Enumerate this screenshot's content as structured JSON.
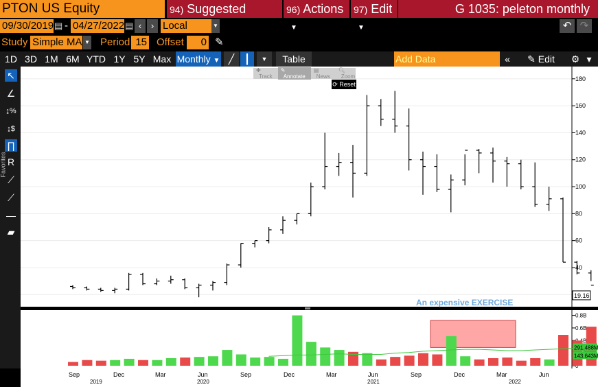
{
  "header": {
    "ticker": "PTON US Equity",
    "menu_suggested_num": "94)",
    "menu_suggested": "Suggested Charts",
    "menu_actions_num": "96)",
    "menu_actions": "Actions",
    "menu_edit_num": "97)",
    "menu_edit": "Edit",
    "chart_title": "G 1035: peleton monthly"
  },
  "range": {
    "start": "09/30/2019",
    "end": "04/27/2022",
    "currency": "Local CCY"
  },
  "study": {
    "label": "Study",
    "type": "Simple MA",
    "period_label": "Period",
    "period": "15",
    "offset_label": "Offset",
    "offset": "0"
  },
  "toolbar": {
    "periods": [
      "1D",
      "3D",
      "1M",
      "6M",
      "YTD",
      "1Y",
      "5Y",
      "Max"
    ],
    "frequency": "Monthly",
    "table_label": "Table",
    "add_data_placeholder": "Add Data",
    "edit_chart": "Edit Chart"
  },
  "chart_tools": {
    "track": "Track",
    "annotate": "Annotate",
    "news": "News",
    "zoom": "Zoom",
    "reset": "Reset"
  },
  "favorites_label": "Favorites",
  "annotation": "An expensive EXERCISE",
  "colors": {
    "up": "#4ed84e",
    "down": "#e84a4a",
    "ma": "#3cc83c",
    "orange": "#f7941d",
    "red": "#a8172b",
    "highlight": "#ff8080"
  },
  "chart_data": {
    "type": "ohlc",
    "price_axis": {
      "ticks": [
        20,
        40,
        60,
        80,
        100,
        120,
        140,
        160,
        180
      ],
      "range": [
        12,
        185
      ],
      "last_value": "19.16"
    },
    "volume_axis": {
      "ticks": [
        "0",
        "0.2B",
        "0.4B",
        "0.6B",
        "0.8B"
      ],
      "range": [
        0,
        0.85
      ],
      "ma_label": "291.488M",
      "vol_label": "143.643M"
    },
    "x_axis": {
      "months": [
        "Sep",
        "Dec",
        "Mar",
        "Jun",
        "Sep",
        "Dec",
        "Mar",
        "Jun",
        "Sep",
        "Dec",
        "Mar",
        "Jun"
      ],
      "years": [
        "2019",
        "2020",
        "2021",
        "2022"
      ]
    },
    "bars": [
      {
        "o": 26,
        "h": 27,
        "l": 24,
        "c": 25,
        "v": 0.06
      },
      {
        "o": 25,
        "h": 26,
        "l": 23,
        "c": 24,
        "v": 0.09
      },
      {
        "o": 24,
        "h": 25,
        "l": 22,
        "c": 23,
        "v": 0.08
      },
      {
        "o": 23,
        "h": 25,
        "l": 21,
        "c": 24,
        "v": 0.09
      },
      {
        "o": 24,
        "h": 36,
        "l": 23,
        "c": 35,
        "v": 0.11
      },
      {
        "o": 35,
        "h": 36,
        "l": 27,
        "c": 28,
        "v": 0.09
      },
      {
        "o": 28,
        "h": 32,
        "l": 27,
        "c": 30,
        "v": 0.09
      },
      {
        "o": 30,
        "h": 34,
        "l": 28,
        "c": 31,
        "v": 0.12
      },
      {
        "o": 31,
        "h": 32,
        "l": 24,
        "c": 25,
        "v": 0.13
      },
      {
        "o": 25,
        "h": 28,
        "l": 18,
        "c": 27,
        "v": 0.14
      },
      {
        "o": 27,
        "h": 30,
        "l": 23,
        "c": 29,
        "v": 0.15
      },
      {
        "o": 29,
        "h": 43,
        "l": 27,
        "c": 42,
        "v": 0.25
      },
      {
        "o": 42,
        "h": 58,
        "l": 40,
        "c": 58,
        "v": 0.18
      },
      {
        "o": 58,
        "h": 60,
        "l": 55,
        "c": 60,
        "v": 0.13
      },
      {
        "o": 60,
        "h": 70,
        "l": 58,
        "c": 68,
        "v": 0.14
      },
      {
        "o": 68,
        "h": 78,
        "l": 65,
        "c": 75,
        "v": 0.11
      },
      {
        "o": 75,
        "h": 80,
        "l": 72,
        "c": 80,
        "v": 0.8
      },
      {
        "o": 80,
        "h": 103,
        "l": 78,
        "c": 100,
        "v": 0.38
      },
      {
        "o": 100,
        "h": 140,
        "l": 98,
        "c": 115,
        "v": 0.29
      },
      {
        "o": 115,
        "h": 125,
        "l": 108,
        "c": 118,
        "v": 0.25
      },
      {
        "o": 118,
        "h": 131,
        "l": 92,
        "c": 110,
        "v": 0.22
      },
      {
        "o": 110,
        "h": 168,
        "l": 108,
        "c": 160,
        "v": 0.2
      },
      {
        "o": 160,
        "h": 165,
        "l": 145,
        "c": 150,
        "v": 0.1
      },
      {
        "o": 150,
        "h": 171,
        "l": 140,
        "c": 145,
        "v": 0.14
      },
      {
        "o": 145,
        "h": 158,
        "l": 112,
        "c": 120,
        "v": 0.16
      },
      {
        "o": 120,
        "h": 126,
        "l": 94,
        "c": 115,
        "v": 0.2
      },
      {
        "o": 115,
        "h": 124,
        "l": 96,
        "c": 98,
        "v": 0.18
      },
      {
        "o": 98,
        "h": 109,
        "l": 81,
        "c": 105,
        "v": 0.47
      },
      {
        "o": 105,
        "h": 124,
        "l": 101,
        "c": 127,
        "v": 0.15
      },
      {
        "o": 127,
        "h": 128,
        "l": 110,
        "c": 125,
        "v": 0.1
      },
      {
        "o": 125,
        "h": 129,
        "l": 103,
        "c": 119,
        "v": 0.12
      },
      {
        "o": 119,
        "h": 122,
        "l": 100,
        "c": 117,
        "v": 0.13
      },
      {
        "o": 117,
        "h": 120,
        "l": 98,
        "c": 100,
        "v": 0.08
      },
      {
        "o": 100,
        "h": 118,
        "l": 85,
        "c": 87,
        "v": 0.12
      },
      {
        "o": 87,
        "h": 100,
        "l": 82,
        "c": 91,
        "v": 0.1
      },
      {
        "o": 91,
        "h": 92,
        "l": 44,
        "c": 44,
        "v": 0.49
      },
      {
        "o": 44,
        "h": 45,
        "l": 35,
        "c": 36,
        "v": 0.4
      },
      {
        "o": 36,
        "h": 38,
        "l": 30,
        "c": 27,
        "v": 0.62
      },
      {
        "o": 27,
        "h": 40,
        "l": 22,
        "c": 26,
        "v": 0.68
      },
      {
        "o": 26,
        "h": 33,
        "l": 22,
        "c": 28,
        "v": 0.2
      },
      {
        "o": 28,
        "h": 28,
        "l": 19,
        "c": 19.16,
        "v": 0.14
      }
    ],
    "volume_ma": [
      0.15,
      0.16,
      0.17,
      0.17,
      0.18,
      0.19,
      0.18,
      0.18,
      0.18,
      0.2,
      0.21,
      0.23,
      0.24,
      0.25,
      0.26,
      0.26,
      0.25,
      0.24,
      0.24,
      0.25,
      0.26,
      0.27,
      0.28,
      0.29
    ]
  }
}
